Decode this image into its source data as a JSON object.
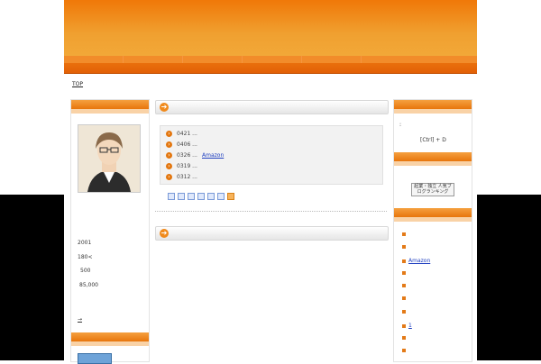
{
  "breadcrumb": {
    "label": "TOP"
  },
  "profile": {
    "year": "2001",
    "height": "180<",
    "v1": "500",
    "v2": "85,000",
    "more": "→"
  },
  "main": {
    "entries": [
      {
        "date": "0421 ...",
        "title": ""
      },
      {
        "date": "0406 ...",
        "title": ""
      },
      {
        "date": "0326 ...",
        "title": "Amazon"
      },
      {
        "date": "0319 ...",
        "title": ""
      },
      {
        "date": "0312 ...",
        "title": ""
      }
    ]
  },
  "right": {
    "bookmark_text": "[Ctrl] + D",
    "colon": ":",
    "banner_text": "起業・独立 人気ブログランキング",
    "items": [
      {
        "label": ""
      },
      {
        "label": ""
      },
      {
        "label": "Amazon"
      },
      {
        "label": ""
      },
      {
        "label": ""
      },
      {
        "label": ""
      },
      {
        "label": ""
      },
      {
        "label": "1"
      },
      {
        "label": ""
      },
      {
        "label": ""
      }
    ]
  },
  "colors": {
    "accent": "#f08a1c",
    "link": "#2040c0"
  }
}
